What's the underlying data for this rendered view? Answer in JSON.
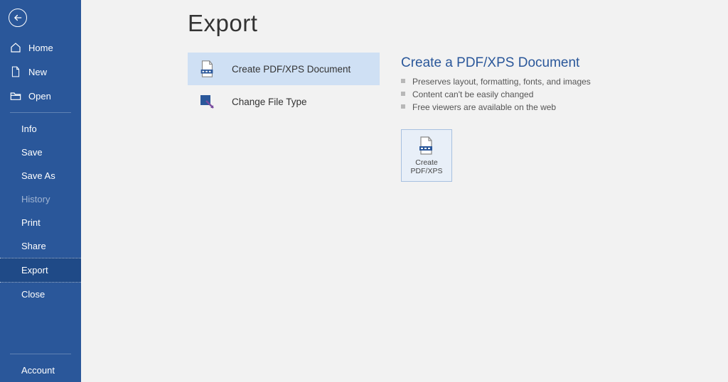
{
  "sidebar": {
    "nav": [
      {
        "label": "Home"
      },
      {
        "label": "New"
      },
      {
        "label": "Open"
      }
    ],
    "sub": {
      "info": {
        "label": "Info"
      },
      "save": {
        "label": "Save"
      },
      "saveas": {
        "label": "Save As"
      },
      "history": {
        "label": "History"
      },
      "print": {
        "label": "Print"
      },
      "share": {
        "label": "Share"
      },
      "export": {
        "label": "Export"
      },
      "close": {
        "label": "Close"
      }
    },
    "footer": {
      "account": {
        "label": "Account"
      }
    }
  },
  "page": {
    "title": "Export"
  },
  "options": {
    "pdf": {
      "label": "Create PDF/XPS Document"
    },
    "filetype": {
      "label": "Change File Type"
    }
  },
  "detail": {
    "heading": "Create a PDF/XPS Document",
    "bullets": [
      "Preserves layout, formatting, fonts, and images",
      "Content can't be easily changed",
      "Free viewers are available on the web"
    ],
    "button_label": "Create\nPDF/XPS"
  }
}
